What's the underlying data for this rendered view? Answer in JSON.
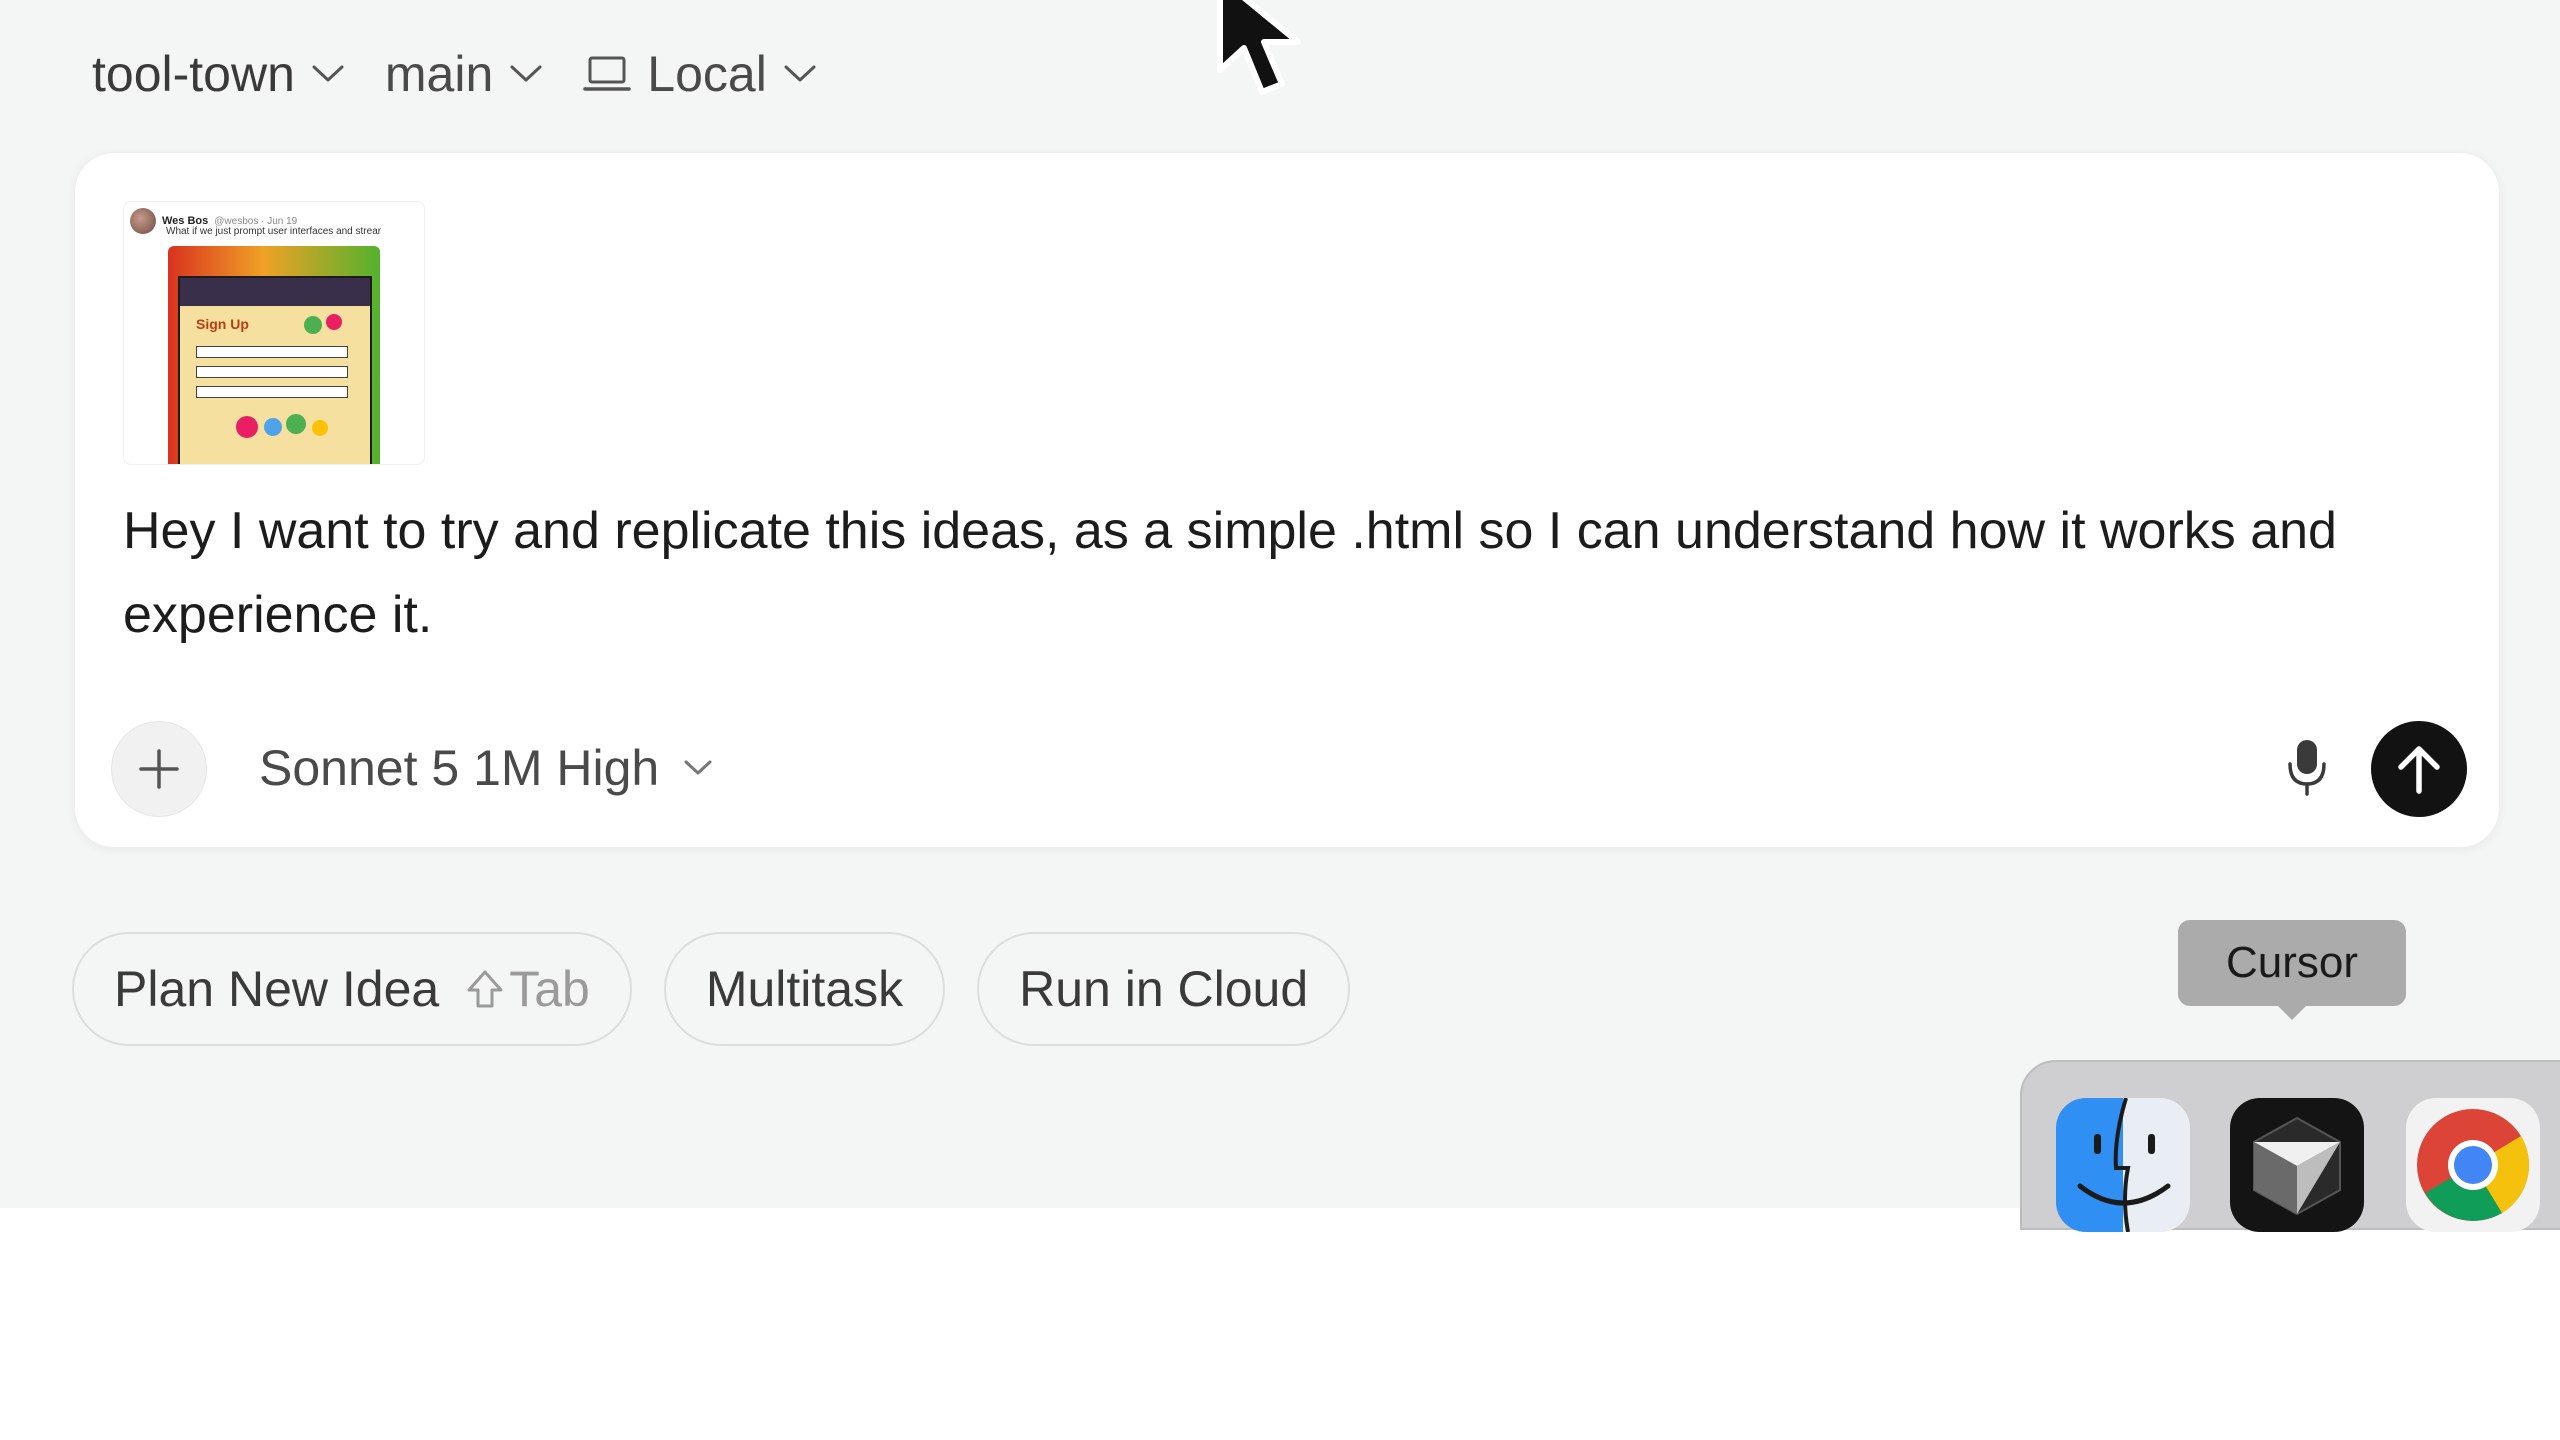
{
  "topbar": {
    "project": "tool-town",
    "branch": "main",
    "environment": "Local"
  },
  "composer": {
    "attachment": {
      "author": "Wes Bos",
      "handle": "@wesbos · Jun 19",
      "tweet_text": "What if we just prompt user interfaces and strear",
      "image_heading": "Sign Up"
    },
    "prompt_text": "Hey I want to try and replicate this ideas, as a simple .html so I can understand how it works and experience it.",
    "model_label": "Sonnet 5 1M High"
  },
  "chips": [
    {
      "label": "Plan New Idea",
      "shortcut": "Tab"
    },
    {
      "label": "Multitask"
    },
    {
      "label": "Run in Cloud"
    }
  ],
  "dock": {
    "tooltip": "Cursor",
    "apps": [
      "finder-icon",
      "cursor-app-icon",
      "chrome-icon"
    ]
  },
  "colors": {
    "background": "#f4f5f5",
    "send_button": "#121212",
    "tooltip": "#ababab"
  }
}
